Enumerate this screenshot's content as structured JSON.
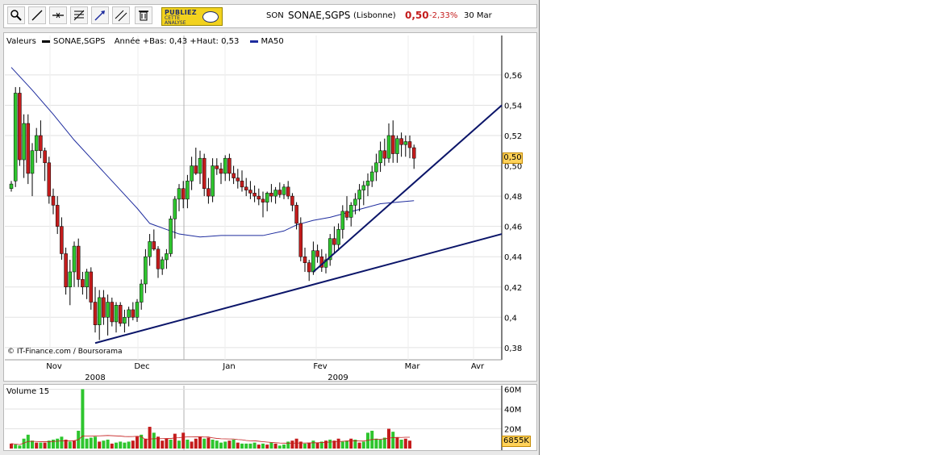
{
  "header": {
    "ticker": "SON",
    "name": "SONAE,SGPS",
    "market": "(Lisbonne)",
    "price": "0,50",
    "change": "-2,33%",
    "date": "30 Mar"
  },
  "ad": {
    "line1": "PUBLIEZ",
    "line2": "CETTE ANALYSE"
  },
  "toolbar_icons": [
    "zoom-icon",
    "line-tool-icon",
    "horizontal-line-icon",
    "fibonacci-icon",
    "trend-arrow-icon",
    "parallel-lines-icon",
    "trash-icon"
  ],
  "legend": {
    "values_label": "Valeurs",
    "series_name": "SONAE,SGPS",
    "range_text": "Année +Bas: 0,43 +Haut: 0,53",
    "ma_name": "MA50"
  },
  "copyright": "© IT-Finance.com / Boursorama",
  "badges": {
    "last_price": "0,50",
    "last_volume": "6855K"
  },
  "volume_label": "Volume 15",
  "colors": {
    "up": "#2ec52e",
    "down": "#c41c1c",
    "ma": "#1e2c9e",
    "trend": "#0b1569",
    "badge": "#ffd25a"
  },
  "chart_data": {
    "type": "candlestick",
    "y_ticks": [
      "0,56",
      "0,54",
      "0,52",
      "0,50",
      "0,48",
      "0,46",
      "0,44",
      "0,42",
      "0,4",
      "0,38"
    ],
    "ylim": [
      0.373,
      0.577
    ],
    "x_month_labels": [
      "Nov",
      "Dec",
      "Jan",
      "Fev",
      "Mar",
      "Avr"
    ],
    "x_year_labels": [
      "2008",
      "2009"
    ],
    "ohlc": [
      [
        0.485,
        0.49,
        0.483,
        0.488
      ],
      [
        0.49,
        0.552,
        0.486,
        0.548
      ],
      [
        0.548,
        0.552,
        0.5,
        0.504
      ],
      [
        0.504,
        0.534,
        0.492,
        0.528
      ],
      [
        0.528,
        0.534,
        0.488,
        0.495
      ],
      [
        0.495,
        0.515,
        0.48,
        0.51
      ],
      [
        0.51,
        0.525,
        0.502,
        0.52
      ],
      [
        0.52,
        0.53,
        0.505,
        0.51
      ],
      [
        0.51,
        0.512,
        0.49,
        0.502
      ],
      [
        0.502,
        0.506,
        0.475,
        0.48
      ],
      [
        0.48,
        0.485,
        0.468,
        0.474
      ],
      [
        0.474,
        0.48,
        0.455,
        0.46
      ],
      [
        0.46,
        0.466,
        0.438,
        0.442
      ],
      [
        0.442,
        0.446,
        0.415,
        0.42
      ],
      [
        0.42,
        0.438,
        0.408,
        0.43
      ],
      [
        0.43,
        0.45,
        0.42,
        0.447
      ],
      [
        0.447,
        0.452,
        0.42,
        0.425
      ],
      [
        0.425,
        0.43,
        0.415,
        0.42
      ],
      [
        0.42,
        0.432,
        0.412,
        0.43
      ],
      [
        0.43,
        0.433,
        0.405,
        0.41
      ],
      [
        0.41,
        0.42,
        0.39,
        0.395
      ],
      [
        0.395,
        0.418,
        0.385,
        0.413
      ],
      [
        0.413,
        0.418,
        0.395,
        0.4
      ],
      [
        0.4,
        0.415,
        0.388,
        0.41
      ],
      [
        0.41,
        0.413,
        0.394,
        0.397
      ],
      [
        0.397,
        0.41,
        0.39,
        0.408
      ],
      [
        0.408,
        0.41,
        0.394,
        0.396
      ],
      [
        0.396,
        0.405,
        0.39,
        0.4
      ],
      [
        0.4,
        0.407,
        0.394,
        0.405
      ],
      [
        0.405,
        0.41,
        0.398,
        0.4
      ],
      [
        0.4,
        0.412,
        0.397,
        0.41
      ],
      [
        0.41,
        0.425,
        0.405,
        0.422
      ],
      [
        0.422,
        0.445,
        0.416,
        0.44
      ],
      [
        0.44,
        0.455,
        0.434,
        0.45
      ],
      [
        0.45,
        0.458,
        0.444,
        0.445
      ],
      [
        0.445,
        0.447,
        0.426,
        0.432
      ],
      [
        0.432,
        0.44,
        0.428,
        0.438
      ],
      [
        0.438,
        0.445,
        0.432,
        0.442
      ],
      [
        0.442,
        0.467,
        0.44,
        0.465
      ],
      [
        0.465,
        0.48,
        0.452,
        0.478
      ],
      [
        0.478,
        0.488,
        0.47,
        0.485
      ],
      [
        0.485,
        0.49,
        0.472,
        0.478
      ],
      [
        0.478,
        0.494,
        0.472,
        0.49
      ],
      [
        0.49,
        0.506,
        0.484,
        0.5
      ],
      [
        0.5,
        0.512,
        0.494,
        0.495
      ],
      [
        0.495,
        0.51,
        0.488,
        0.505
      ],
      [
        0.505,
        0.508,
        0.48,
        0.485
      ],
      [
        0.485,
        0.492,
        0.475,
        0.48
      ],
      [
        0.48,
        0.505,
        0.476,
        0.5
      ],
      [
        0.5,
        0.505,
        0.494,
        0.498
      ],
      [
        0.498,
        0.502,
        0.488,
        0.495
      ],
      [
        0.495,
        0.507,
        0.49,
        0.505
      ],
      [
        0.505,
        0.508,
        0.49,
        0.495
      ],
      [
        0.495,
        0.5,
        0.488,
        0.492
      ],
      [
        0.492,
        0.498,
        0.485,
        0.49
      ],
      [
        0.49,
        0.497,
        0.483,
        0.486
      ],
      [
        0.486,
        0.492,
        0.48,
        0.484
      ],
      [
        0.484,
        0.49,
        0.478,
        0.482
      ],
      [
        0.482,
        0.487,
        0.476,
        0.48
      ],
      [
        0.48,
        0.485,
        0.474,
        0.478
      ],
      [
        0.478,
        0.483,
        0.466,
        0.476
      ],
      [
        0.476,
        0.483,
        0.47,
        0.482
      ],
      [
        0.482,
        0.488,
        0.476,
        0.48
      ],
      [
        0.48,
        0.486,
        0.475,
        0.484
      ],
      [
        0.484,
        0.489,
        0.479,
        0.481
      ],
      [
        0.481,
        0.488,
        0.478,
        0.486
      ],
      [
        0.486,
        0.49,
        0.478,
        0.48
      ],
      [
        0.48,
        0.482,
        0.47,
        0.474
      ],
      [
        0.474,
        0.476,
        0.458,
        0.462
      ],
      [
        0.462,
        0.466,
        0.437,
        0.44
      ],
      [
        0.44,
        0.446,
        0.43,
        0.436
      ],
      [
        0.436,
        0.438,
        0.424,
        0.43
      ],
      [
        0.43,
        0.45,
        0.428,
        0.444
      ],
      [
        0.444,
        0.448,
        0.436,
        0.44
      ],
      [
        0.44,
        0.445,
        0.43,
        0.433
      ],
      [
        0.433,
        0.442,
        0.429,
        0.438
      ],
      [
        0.438,
        0.455,
        0.434,
        0.452
      ],
      [
        0.452,
        0.46,
        0.442,
        0.448
      ],
      [
        0.448,
        0.462,
        0.444,
        0.458
      ],
      [
        0.458,
        0.474,
        0.452,
        0.47
      ],
      [
        0.47,
        0.48,
        0.464,
        0.466
      ],
      [
        0.466,
        0.476,
        0.46,
        0.474
      ],
      [
        0.474,
        0.482,
        0.468,
        0.478
      ],
      [
        0.478,
        0.488,
        0.47,
        0.484
      ],
      [
        0.484,
        0.49,
        0.474,
        0.487
      ],
      [
        0.487,
        0.495,
        0.48,
        0.49
      ],
      [
        0.49,
        0.5,
        0.486,
        0.496
      ],
      [
        0.496,
        0.508,
        0.49,
        0.502
      ],
      [
        0.502,
        0.516,
        0.496,
        0.51
      ],
      [
        0.51,
        0.518,
        0.5,
        0.505
      ],
      [
        0.505,
        0.528,
        0.502,
        0.52
      ],
      [
        0.52,
        0.53,
        0.502,
        0.508
      ],
      [
        0.508,
        0.52,
        0.502,
        0.518
      ],
      [
        0.518,
        0.522,
        0.506,
        0.514
      ],
      [
        0.514,
        0.52,
        0.506,
        0.516
      ],
      [
        0.516,
        0.52,
        0.505,
        0.512
      ],
      [
        0.512,
        0.514,
        0.498,
        0.505
      ]
    ],
    "ma50": [
      [
        0,
        0.565
      ],
      [
        5,
        0.55
      ],
      [
        10,
        0.534
      ],
      [
        15,
        0.517
      ],
      [
        20,
        0.502
      ],
      [
        25,
        0.487
      ],
      [
        30,
        0.472
      ],
      [
        33,
        0.462
      ],
      [
        37,
        0.458
      ],
      [
        40,
        0.455
      ],
      [
        45,
        0.453
      ],
      [
        50,
        0.454
      ],
      [
        55,
        0.454
      ],
      [
        60,
        0.454
      ],
      [
        65,
        0.457
      ],
      [
        68,
        0.461
      ],
      [
        72,
        0.464
      ],
      [
        76,
        0.466
      ],
      [
        80,
        0.469
      ],
      [
        84,
        0.472
      ],
      [
        88,
        0.475
      ],
      [
        92,
        0.476
      ],
      [
        96,
        0.477
      ]
    ],
    "trendlines": [
      {
        "from": [
          20,
          0.383
        ],
        "to": [
          125,
          0.455
        ]
      },
      {
        "from": [
          72,
          0.43
        ],
        "to": [
          100,
          0.5
        ],
        "ext": [
          125,
          0.54
        ]
      }
    ],
    "volume_axis": [
      "60M",
      "40M",
      "20M"
    ],
    "volume": [
      [
        5,
        0
      ],
      [
        4,
        1
      ],
      [
        3,
        1
      ],
      [
        10,
        1
      ],
      [
        14,
        1
      ],
      [
        8,
        1
      ],
      [
        6,
        0
      ],
      [
        6,
        1
      ],
      [
        6,
        0
      ],
      [
        8,
        1
      ],
      [
        9,
        1
      ],
      [
        10,
        1
      ],
      [
        12,
        1
      ],
      [
        9,
        0
      ],
      [
        7,
        1
      ],
      [
        8,
        0
      ],
      [
        18,
        1
      ],
      [
        60,
        1
      ],
      [
        10,
        1
      ],
      [
        11,
        1
      ],
      [
        12,
        1
      ],
      [
        7,
        0
      ],
      [
        8,
        1
      ],
      [
        9,
        1
      ],
      [
        5,
        0
      ],
      [
        6,
        1
      ],
      [
        7,
        1
      ],
      [
        6,
        1
      ],
      [
        7,
        1
      ],
      [
        8,
        0
      ],
      [
        12,
        0
      ],
      [
        14,
        1
      ],
      [
        10,
        0
      ],
      [
        22,
        0
      ],
      [
        16,
        1
      ],
      [
        12,
        0
      ],
      [
        8,
        0
      ],
      [
        10,
        0
      ],
      [
        9,
        1
      ],
      [
        15,
        0
      ],
      [
        8,
        1
      ],
      [
        16,
        0
      ],
      [
        9,
        1
      ],
      [
        7,
        0
      ],
      [
        10,
        0
      ],
      [
        12,
        0
      ],
      [
        10,
        1
      ],
      [
        11,
        0
      ],
      [
        9,
        1
      ],
      [
        8,
        1
      ],
      [
        6,
        1
      ],
      [
        7,
        1
      ],
      [
        8,
        0
      ],
      [
        9,
        1
      ],
      [
        6,
        0
      ],
      [
        5,
        1
      ],
      [
        5,
        1
      ],
      [
        5,
        1
      ],
      [
        6,
        1
      ],
      [
        4,
        0
      ],
      [
        5,
        1
      ],
      [
        4,
        0
      ],
      [
        6,
        1
      ],
      [
        5,
        0
      ],
      [
        3,
        1
      ],
      [
        4,
        1
      ],
      [
        7,
        1
      ],
      [
        8,
        0
      ],
      [
        10,
        0
      ],
      [
        7,
        0
      ],
      [
        5,
        1
      ],
      [
        6,
        0
      ],
      [
        8,
        1
      ],
      [
        6,
        0
      ],
      [
        7,
        1
      ],
      [
        8,
        0
      ],
      [
        9,
        1
      ],
      [
        8,
        0
      ],
      [
        10,
        0
      ],
      [
        7,
        1
      ],
      [
        8,
        1
      ],
      [
        10,
        0
      ],
      [
        9,
        1
      ],
      [
        6,
        0
      ],
      [
        7,
        1
      ],
      [
        16,
        1
      ],
      [
        18,
        1
      ],
      [
        10,
        1
      ],
      [
        9,
        1
      ],
      [
        11,
        1
      ],
      [
        20,
        0
      ],
      [
        17,
        1
      ],
      [
        11,
        0
      ],
      [
        9,
        1
      ],
      [
        10,
        0
      ],
      [
        8,
        0
      ]
    ]
  }
}
